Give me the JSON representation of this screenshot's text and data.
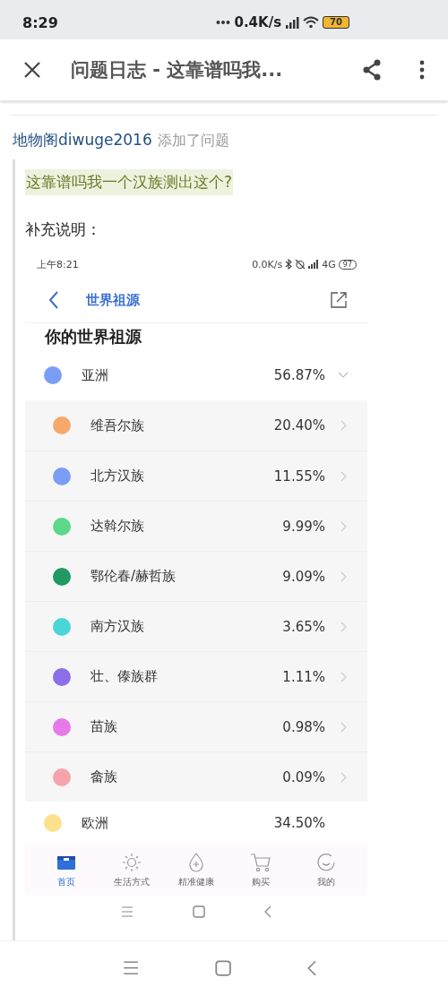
{
  "status_bar": {
    "time": "8:29",
    "speed": "0.4K/s",
    "battery": "70"
  },
  "app_bar": {
    "title": "问题日志 - 这靠谱吗我..."
  },
  "log": {
    "author": "地物阁diwuge2016",
    "action": "添加了问题",
    "question": "这靠谱吗我一个汉族测出这个?",
    "supplement_label": "补充说明："
  },
  "embedded_screenshot": {
    "status_bar": {
      "time": "上午8:21",
      "speed": "0.0K/s",
      "network": "4G",
      "battery": "97"
    },
    "nav": {
      "title": "世界祖源"
    },
    "heading": "你的世界祖源",
    "regions": [
      {
        "name": "亚洲",
        "percent": "56.87%",
        "color": "#7a9ef5",
        "expanded": true,
        "children": [
          {
            "name": "维吾尔族",
            "percent": "20.40%",
            "color": "#f7a86a"
          },
          {
            "name": "北方汉族",
            "percent": "11.55%",
            "color": "#7a9ef5"
          },
          {
            "name": "达斡尔族",
            "percent": "9.99%",
            "color": "#5dd88a"
          },
          {
            "name": "鄂伦春/赫哲族",
            "percent": "9.09%",
            "color": "#1f9a62"
          },
          {
            "name": "南方汉族",
            "percent": "3.65%",
            "color": "#4ad6d6"
          },
          {
            "name": "壮、傣族群",
            "percent": "1.11%",
            "color": "#8b6ee8"
          },
          {
            "name": "苗族",
            "percent": "0.98%",
            "color": "#e77ae8"
          },
          {
            "name": "畲族",
            "percent": "0.09%",
            "color": "#f7a3ad"
          }
        ]
      },
      {
        "name": "欧洲",
        "percent": "34.50%",
        "color": "#fbe08e",
        "expanded": false
      }
    ],
    "tab_bar": [
      {
        "kind": "home",
        "label": "首页",
        "selected": true
      },
      {
        "kind": "sun",
        "label": "生活方式",
        "selected": false
      },
      {
        "kind": "drop",
        "label": "精准健康",
        "selected": false
      },
      {
        "kind": "cart",
        "label": "购买",
        "selected": false
      },
      {
        "kind": "smile",
        "label": "我的",
        "selected": false
      }
    ]
  }
}
